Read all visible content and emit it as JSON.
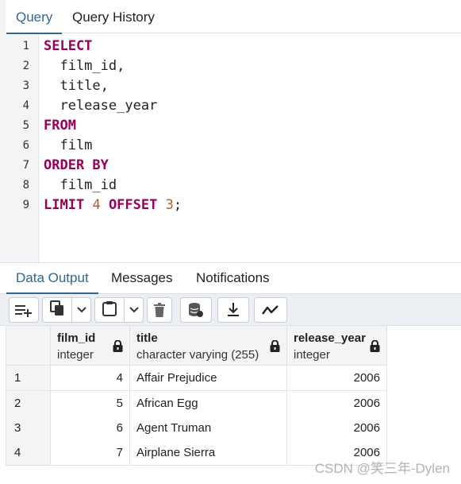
{
  "tabs": {
    "query": "Query",
    "history": "Query History"
  },
  "editor": {
    "lines": [
      {
        "n": "1",
        "tokens": [
          {
            "t": "SELECT",
            "k": "kw"
          }
        ]
      },
      {
        "n": "2",
        "tokens": [
          {
            "t": "  film_id,",
            "k": ""
          }
        ]
      },
      {
        "n": "3",
        "tokens": [
          {
            "t": "  title,",
            "k": ""
          }
        ]
      },
      {
        "n": "4",
        "tokens": [
          {
            "t": "  release_year",
            "k": ""
          }
        ]
      },
      {
        "n": "5",
        "tokens": [
          {
            "t": "FROM",
            "k": "kw"
          }
        ]
      },
      {
        "n": "6",
        "tokens": [
          {
            "t": "  film",
            "k": ""
          }
        ]
      },
      {
        "n": "7",
        "tokens": [
          {
            "t": "ORDER BY",
            "k": "kw"
          }
        ]
      },
      {
        "n": "8",
        "tokens": [
          {
            "t": "  film_id",
            "k": ""
          }
        ]
      },
      {
        "n": "9",
        "tokens": [
          {
            "t": "LIMIT",
            "k": "kw"
          },
          {
            "t": " ",
            "k": ""
          },
          {
            "t": "4",
            "k": "num"
          },
          {
            "t": " ",
            "k": ""
          },
          {
            "t": "OFFSET",
            "k": "kw"
          },
          {
            "t": " ",
            "k": ""
          },
          {
            "t": "3",
            "k": "num"
          },
          {
            "t": ";",
            "k": ""
          }
        ]
      }
    ]
  },
  "output_tabs": {
    "data_output": "Data Output",
    "messages": "Messages",
    "notifications": "Notifications"
  },
  "toolbar": {
    "icons": [
      "add-row-icon",
      "copy-icon",
      "dropdown-icon",
      "paste-icon",
      "dropdown-icon",
      "delete-icon",
      "save-data-icon",
      "download-icon",
      "graph-visualiser-icon"
    ]
  },
  "grid": {
    "columns": [
      {
        "name": "film_id",
        "type": "integer"
      },
      {
        "name": "title",
        "type": "character varying (255)"
      },
      {
        "name": "release_year",
        "type": "integer"
      }
    ],
    "rows": [
      {
        "rn": "1",
        "film_id": "4",
        "title": "Affair Prejudice",
        "release_year": "2006"
      },
      {
        "rn": "2",
        "film_id": "5",
        "title": "African Egg",
        "release_year": "2006"
      },
      {
        "rn": "3",
        "film_id": "6",
        "title": "Agent Truman",
        "release_year": "2006"
      },
      {
        "rn": "4",
        "film_id": "7",
        "title": "Airplane Sierra",
        "release_year": "2006"
      }
    ]
  },
  "watermark": "CSDN @笑三年-Dylen",
  "colors": {
    "accent": "#326690",
    "keyword": "#990055",
    "number": "#ad5f2f",
    "toolbar_bg": "#ebeef3",
    "header_bg": "#f3f4f6"
  }
}
